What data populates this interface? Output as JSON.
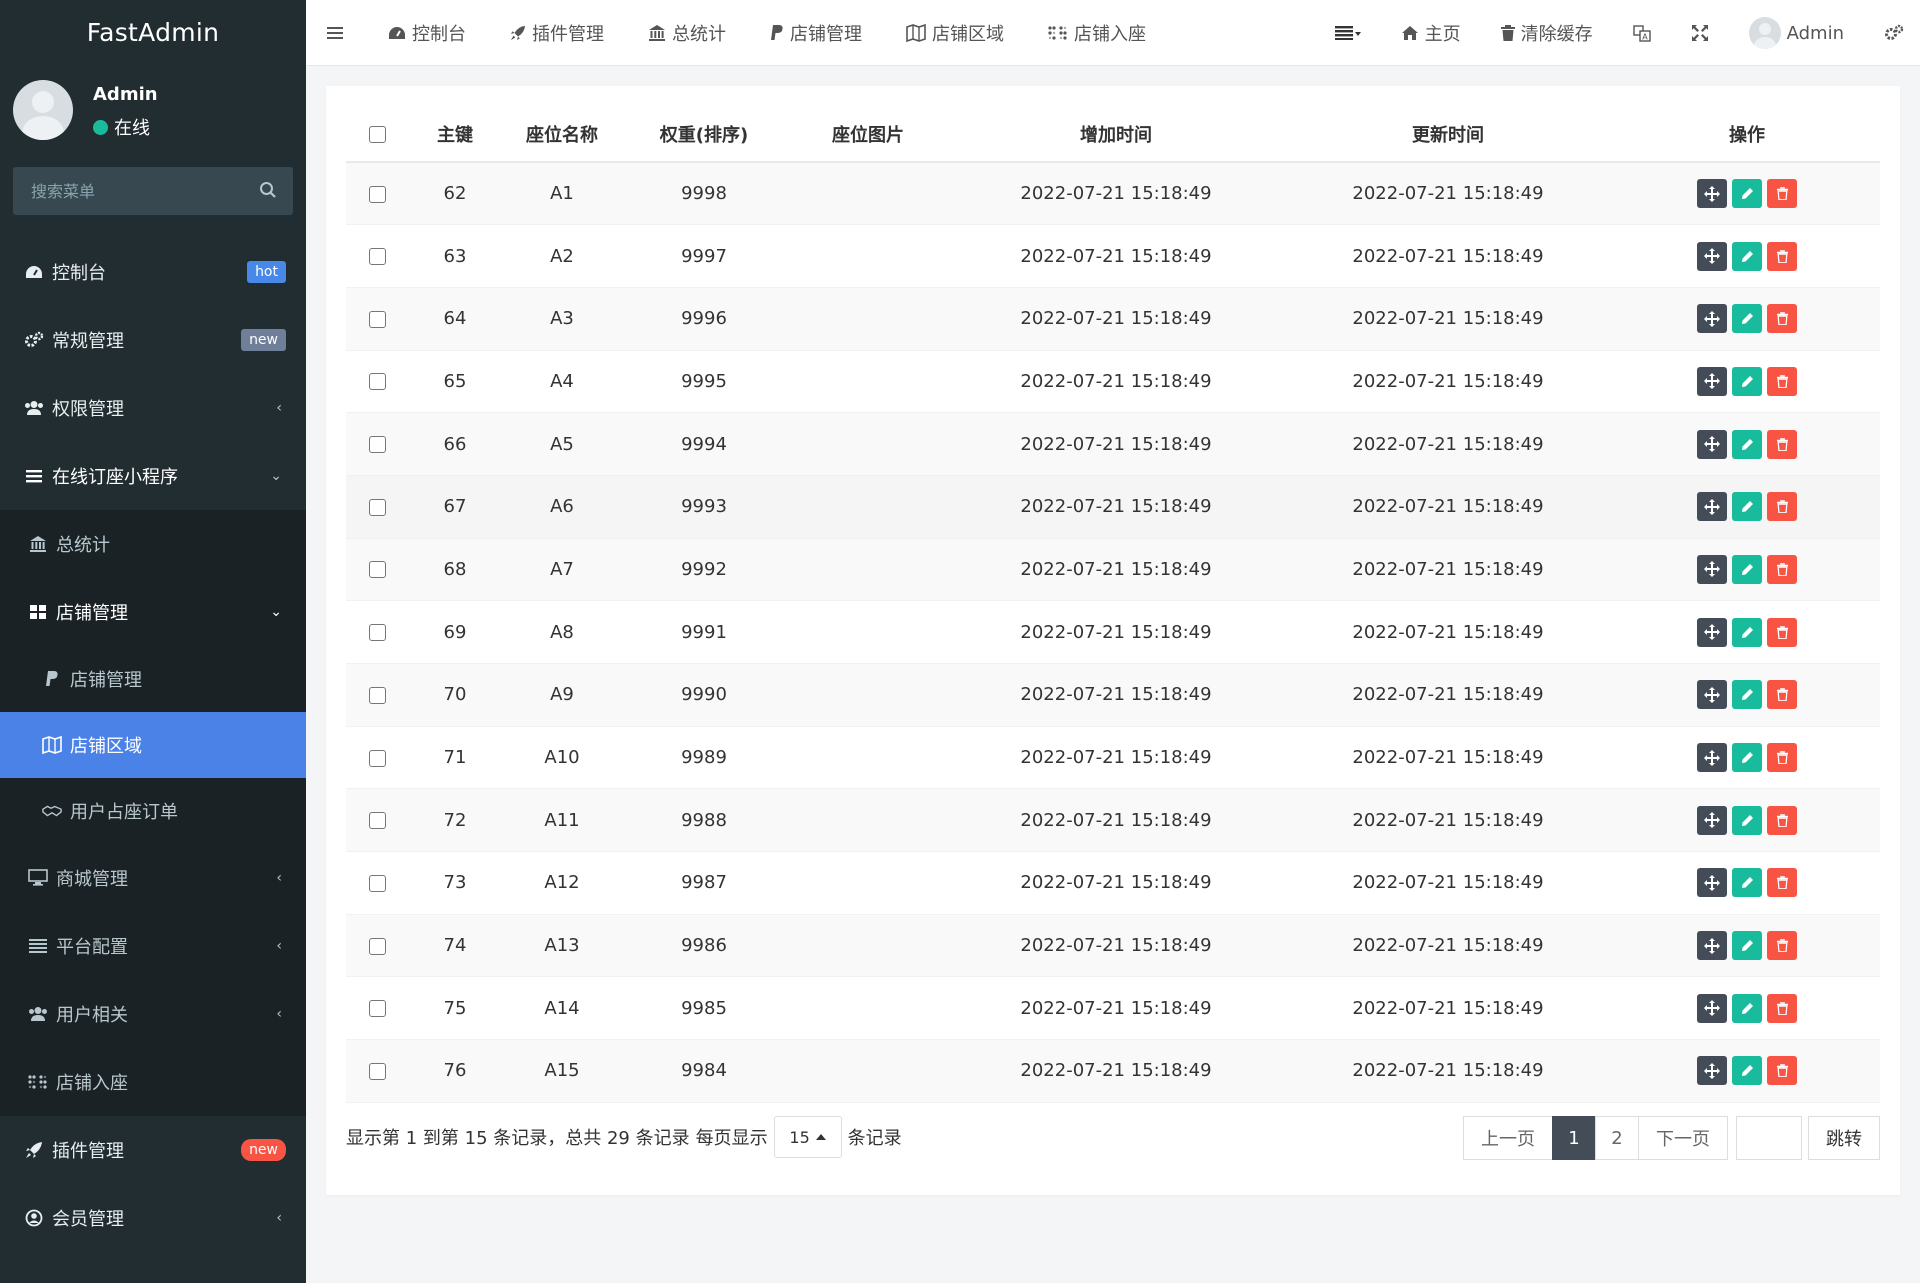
{
  "app": {
    "logo": "FastAdmin"
  },
  "user": {
    "name": "Admin",
    "status": "在线"
  },
  "search": {
    "placeholder": "搜索菜单"
  },
  "menu": {
    "dashboard": {
      "label": "控制台",
      "badge": "hot"
    },
    "general": {
      "label": "常规管理",
      "badge": "new"
    },
    "auth": {
      "label": "权限管理"
    },
    "miniapp": {
      "label": "在线订座小程序"
    },
    "stats": {
      "label": "总统计"
    },
    "shop": {
      "label": "店铺管理"
    },
    "shop_manage": {
      "label": "店铺管理"
    },
    "shop_area": {
      "label": "店铺区域"
    },
    "seat_order": {
      "label": "用户占座订单"
    },
    "mall": {
      "label": "商城管理"
    },
    "platform": {
      "label": "平台配置"
    },
    "users": {
      "label": "用户相关"
    },
    "shop_seat": {
      "label": "店铺入座"
    },
    "plugins": {
      "label": "插件管理",
      "badge": "new"
    },
    "members": {
      "label": "会员管理"
    }
  },
  "navbar": {
    "tabs": [
      "控制台",
      "插件管理",
      "总统计",
      "店铺管理",
      "店铺区域",
      "店铺入座"
    ],
    "home": "主页",
    "clear_cache": "清除缓存",
    "admin": "Admin"
  },
  "table": {
    "headers": [
      "主键",
      "座位名称",
      "权重(排序)",
      "座位图片",
      "增加时间",
      "更新时间",
      "操作"
    ],
    "rows": [
      {
        "id": "62",
        "name": "A1",
        "weight": "9998",
        "created": "2022-07-21 15:18:49",
        "updated": "2022-07-21 15:18:49"
      },
      {
        "id": "63",
        "name": "A2",
        "weight": "9997",
        "created": "2022-07-21 15:18:49",
        "updated": "2022-07-21 15:18:49"
      },
      {
        "id": "64",
        "name": "A3",
        "weight": "9996",
        "created": "2022-07-21 15:18:49",
        "updated": "2022-07-21 15:18:49"
      },
      {
        "id": "65",
        "name": "A4",
        "weight": "9995",
        "created": "2022-07-21 15:18:49",
        "updated": "2022-07-21 15:18:49"
      },
      {
        "id": "66",
        "name": "A5",
        "weight": "9994",
        "created": "2022-07-21 15:18:49",
        "updated": "2022-07-21 15:18:49"
      },
      {
        "id": "67",
        "name": "A6",
        "weight": "9993",
        "created": "2022-07-21 15:18:49",
        "updated": "2022-07-21 15:18:49"
      },
      {
        "id": "68",
        "name": "A7",
        "weight": "9992",
        "created": "2022-07-21 15:18:49",
        "updated": "2022-07-21 15:18:49"
      },
      {
        "id": "69",
        "name": "A8",
        "weight": "9991",
        "created": "2022-07-21 15:18:49",
        "updated": "2022-07-21 15:18:49"
      },
      {
        "id": "70",
        "name": "A9",
        "weight": "9990",
        "created": "2022-07-21 15:18:49",
        "updated": "2022-07-21 15:18:49"
      },
      {
        "id": "71",
        "name": "A10",
        "weight": "9989",
        "created": "2022-07-21 15:18:49",
        "updated": "2022-07-21 15:18:49"
      },
      {
        "id": "72",
        "name": "A11",
        "weight": "9988",
        "created": "2022-07-21 15:18:49",
        "updated": "2022-07-21 15:18:49"
      },
      {
        "id": "73",
        "name": "A12",
        "weight": "9987",
        "created": "2022-07-21 15:18:49",
        "updated": "2022-07-21 15:18:49"
      },
      {
        "id": "74",
        "name": "A13",
        "weight": "9986",
        "created": "2022-07-21 15:18:49",
        "updated": "2022-07-21 15:18:49"
      },
      {
        "id": "75",
        "name": "A14",
        "weight": "9985",
        "created": "2022-07-21 15:18:49",
        "updated": "2022-07-21 15:18:49"
      },
      {
        "id": "76",
        "name": "A15",
        "weight": "9984",
        "created": "2022-07-21 15:18:49",
        "updated": "2022-07-21 15:18:49"
      }
    ]
  },
  "pagination": {
    "info": "显示第 1 到第 15 条记录，总共 29 条记录",
    "per_page_prefix": "每页显示",
    "per_page_value": "15",
    "per_page_suffix": "条记录",
    "prev": "上一页",
    "pages": [
      "1",
      "2"
    ],
    "current": "1",
    "next": "下一页",
    "jump": "跳转"
  },
  "colors": {
    "sidebar_bg": "#222d32",
    "active_menu": "#4b82e8",
    "success": "#18bc9c",
    "danger": "#f75444",
    "dark": "#444c58"
  }
}
